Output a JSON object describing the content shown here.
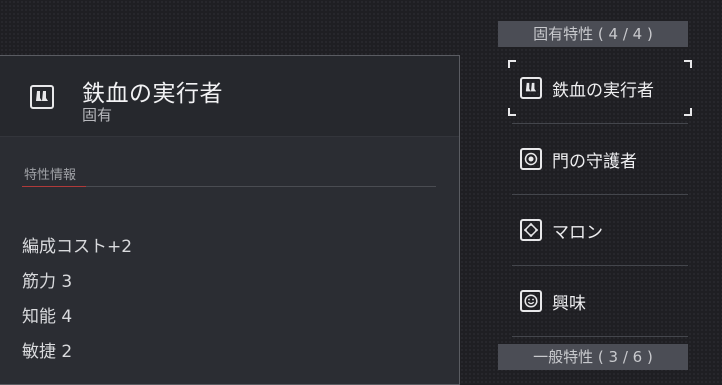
{
  "detail": {
    "title": "鉄血の実行者",
    "subtitle": "固有",
    "icon": "boots-icon",
    "section_label": "特性情報",
    "stats": [
      "編成コスト+2",
      "筋力 3",
      "知能 4",
      "敏捷 2"
    ]
  },
  "traits_panel": {
    "inherent_header": "固有特性 ( 4 / 4 )",
    "general_header": "一般特性 ( 3 / 6 )",
    "items": [
      {
        "label": "鉄血の実行者",
        "icon": "boots-icon",
        "selected": true
      },
      {
        "label": "門の守護者",
        "icon": "shield-badge-icon",
        "selected": false
      },
      {
        "label": "マロン",
        "icon": "diamond-nodes-icon",
        "selected": false
      },
      {
        "label": "興味",
        "icon": "smiley-icon",
        "selected": false
      }
    ]
  },
  "colors": {
    "accent": "#b03a3a",
    "panel": "#2b2d33",
    "header_bar": "#4b4d55"
  }
}
